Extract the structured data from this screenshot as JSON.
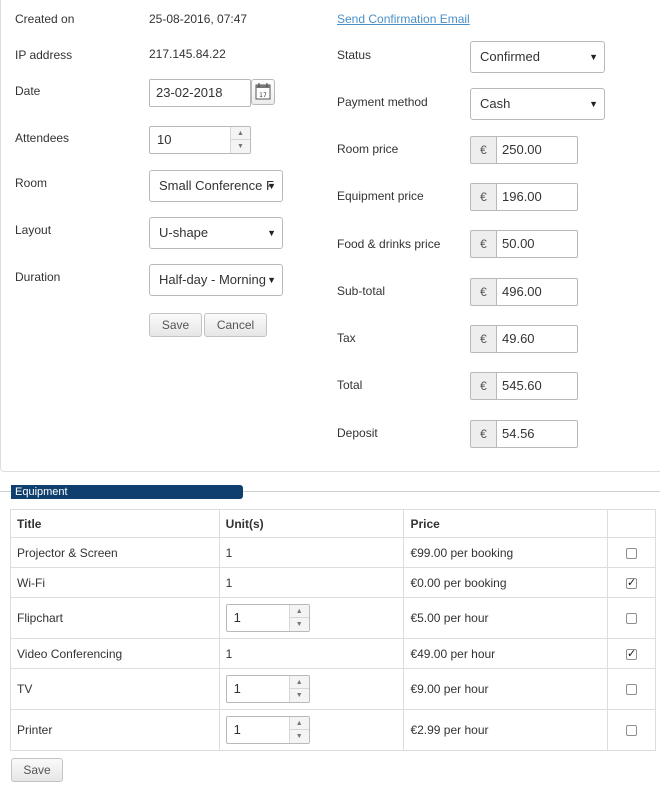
{
  "booking": {
    "created_on_label": "Created on",
    "created_on_value": "25-08-2016, 07:47",
    "send_email_link": "Send Confirmation Email",
    "ip_label": "IP address",
    "ip_value": "217.145.84.22",
    "date_label": "Date",
    "date_value": "23-02-2018",
    "date_icon_text": "17",
    "attendees_label": "Attendees",
    "attendees_value": "10",
    "room_label": "Room",
    "room_value": "Small Conference F",
    "layout_label": "Layout",
    "layout_value": "U-shape",
    "duration_label": "Duration",
    "duration_value": "Half-day - Morning",
    "save_label": "Save",
    "cancel_label": "Cancel"
  },
  "pricing": {
    "status_label": "Status",
    "status_value": "Confirmed",
    "payment_label": "Payment method",
    "payment_value": "Cash",
    "currency": "€",
    "fields": [
      {
        "label": "Room price",
        "value": "250.00"
      },
      {
        "label": "Equipment price",
        "value": "196.00"
      },
      {
        "label": "Food & drinks price",
        "value": "50.00"
      },
      {
        "label": "Sub-total",
        "value": "496.00"
      },
      {
        "label": "Tax",
        "value": "49.60"
      },
      {
        "label": "Total",
        "value": "545.60"
      },
      {
        "label": "Deposit",
        "value": "54.56"
      }
    ]
  },
  "equipment": {
    "section_title": "Equipment",
    "headers": {
      "title": "Title",
      "units": "Unit(s)",
      "price": "Price"
    },
    "rows": [
      {
        "title": "Projector & Screen",
        "units": "1",
        "units_editable": false,
        "price": "€99.00 per booking",
        "checked": false
      },
      {
        "title": "Wi-Fi",
        "units": "1",
        "units_editable": false,
        "price": "€0.00 per booking",
        "checked": true
      },
      {
        "title": "Flipchart",
        "units": "1",
        "units_editable": true,
        "price": "€5.00 per hour",
        "checked": false
      },
      {
        "title": "Video Conferencing",
        "units": "1",
        "units_editable": false,
        "price": "€49.00 per hour",
        "checked": true
      },
      {
        "title": "TV",
        "units": "1",
        "units_editable": true,
        "price": "€9.00 per hour",
        "checked": false
      },
      {
        "title": "Printer",
        "units": "1",
        "units_editable": true,
        "price": "€2.99 per hour",
        "checked": false
      }
    ],
    "save_label": "Save"
  },
  "icons": {
    "select_arrow": "dropdown-arrow-icon",
    "calendar": "calendar-icon",
    "spinner_up": "spinner-up-icon",
    "spinner_down": "spinner-down-icon",
    "checkbox": "checkbox-icon"
  },
  "colors": {
    "section_header_bg": "#0f3f6f",
    "link": "#4a90c8"
  }
}
